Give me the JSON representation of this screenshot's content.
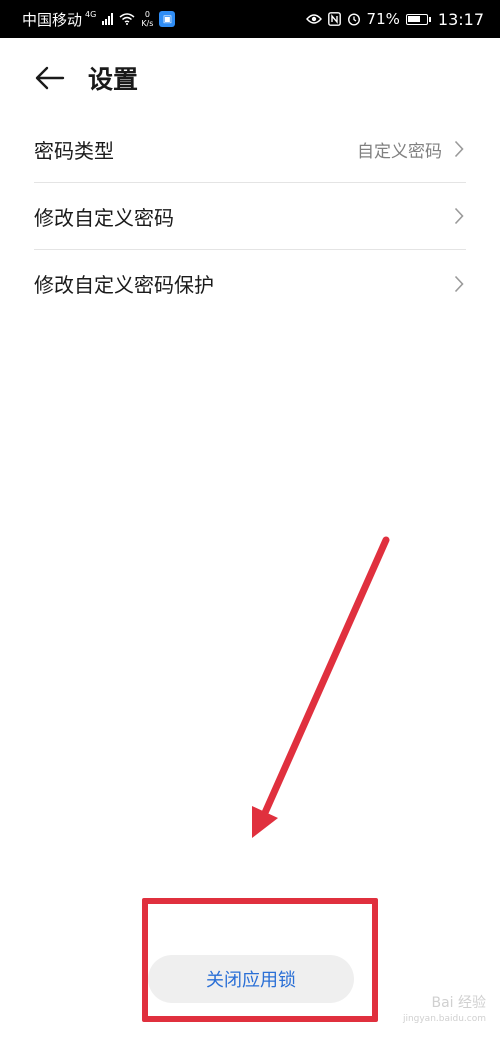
{
  "status_bar": {
    "carrier": "中国移动",
    "network_type": "4G",
    "net_speed_value": "0",
    "net_speed_unit": "K/s",
    "battery_percent": "71%",
    "battery_level": 0.71,
    "time": "13:17",
    "icons": [
      "signal-icon",
      "wifi-icon",
      "app-notification-icon",
      "eye-icon",
      "nfc-icon",
      "alarm-icon",
      "battery-icon"
    ]
  },
  "header": {
    "back_icon": "arrow-left-icon",
    "title": "设置"
  },
  "settings": [
    {
      "label": "密码类型",
      "value": "自定义密码"
    },
    {
      "label": "修改自定义密码",
      "value": ""
    },
    {
      "label": "修改自定义密码保护",
      "value": ""
    }
  ],
  "bottom_button": {
    "label": "关闭应用锁"
  },
  "watermark": {
    "text": "Bai 经验",
    "sub": "jingyan.baidu.com"
  },
  "colors": {
    "accent": "#2a6fd6",
    "annotation": "#e0303e",
    "status_bar_bg": "#000000"
  }
}
